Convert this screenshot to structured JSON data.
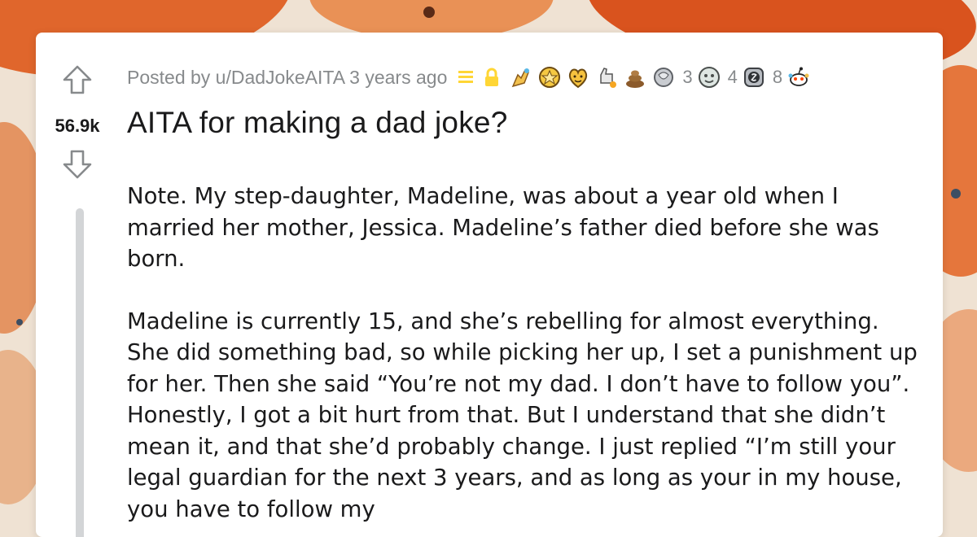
{
  "post": {
    "score": "56.9k",
    "posted_by": "Posted by u/DadJokeAITA 3 years ago",
    "title": "AITA for making a dad joke?",
    "paragraphs": [
      "Note. My step-daughter, Madeline, was about a year old when I married her mother, Jessica. Madeline’s father died before she was born.",
      "Madeline is currently 15, and she’s rebelling for almost everything. She did something bad, so while picking her up, I set a punishment up for her. Then she said “You’re not my dad. I don’t have to follow you”. Honestly, I got a bit hurt from that. But I understand that she didn’t mean it, and that she’d probably change. I just replied “I’m still your legal guardian for the next 3 years, and as long as your in my house, you have to follow my"
    ],
    "awards": [
      {
        "icon": "helping-hand-award-icon",
        "count": ""
      },
      {
        "icon": "gold-award-icon",
        "count": ""
      },
      {
        "icon": "wholesome-award-icon",
        "count": ""
      },
      {
        "icon": "rocket-like-award-icon",
        "count": ""
      },
      {
        "icon": "poop-award-icon",
        "count": ""
      },
      {
        "icon": "silver-award-icon",
        "count": "3"
      },
      {
        "icon": "face-award-icon",
        "count": "4"
      },
      {
        "icon": "coin-award-icon",
        "count": "8"
      },
      {
        "icon": "snoo-award-icon",
        "count": ""
      }
    ]
  },
  "colors": {
    "background": "#efe2d3",
    "accent_orange": "#d9531e",
    "meta_gray": "#878a8c",
    "text": "#1a1a1b",
    "card": "#ffffff",
    "lock_yellow": "#ffd635"
  }
}
